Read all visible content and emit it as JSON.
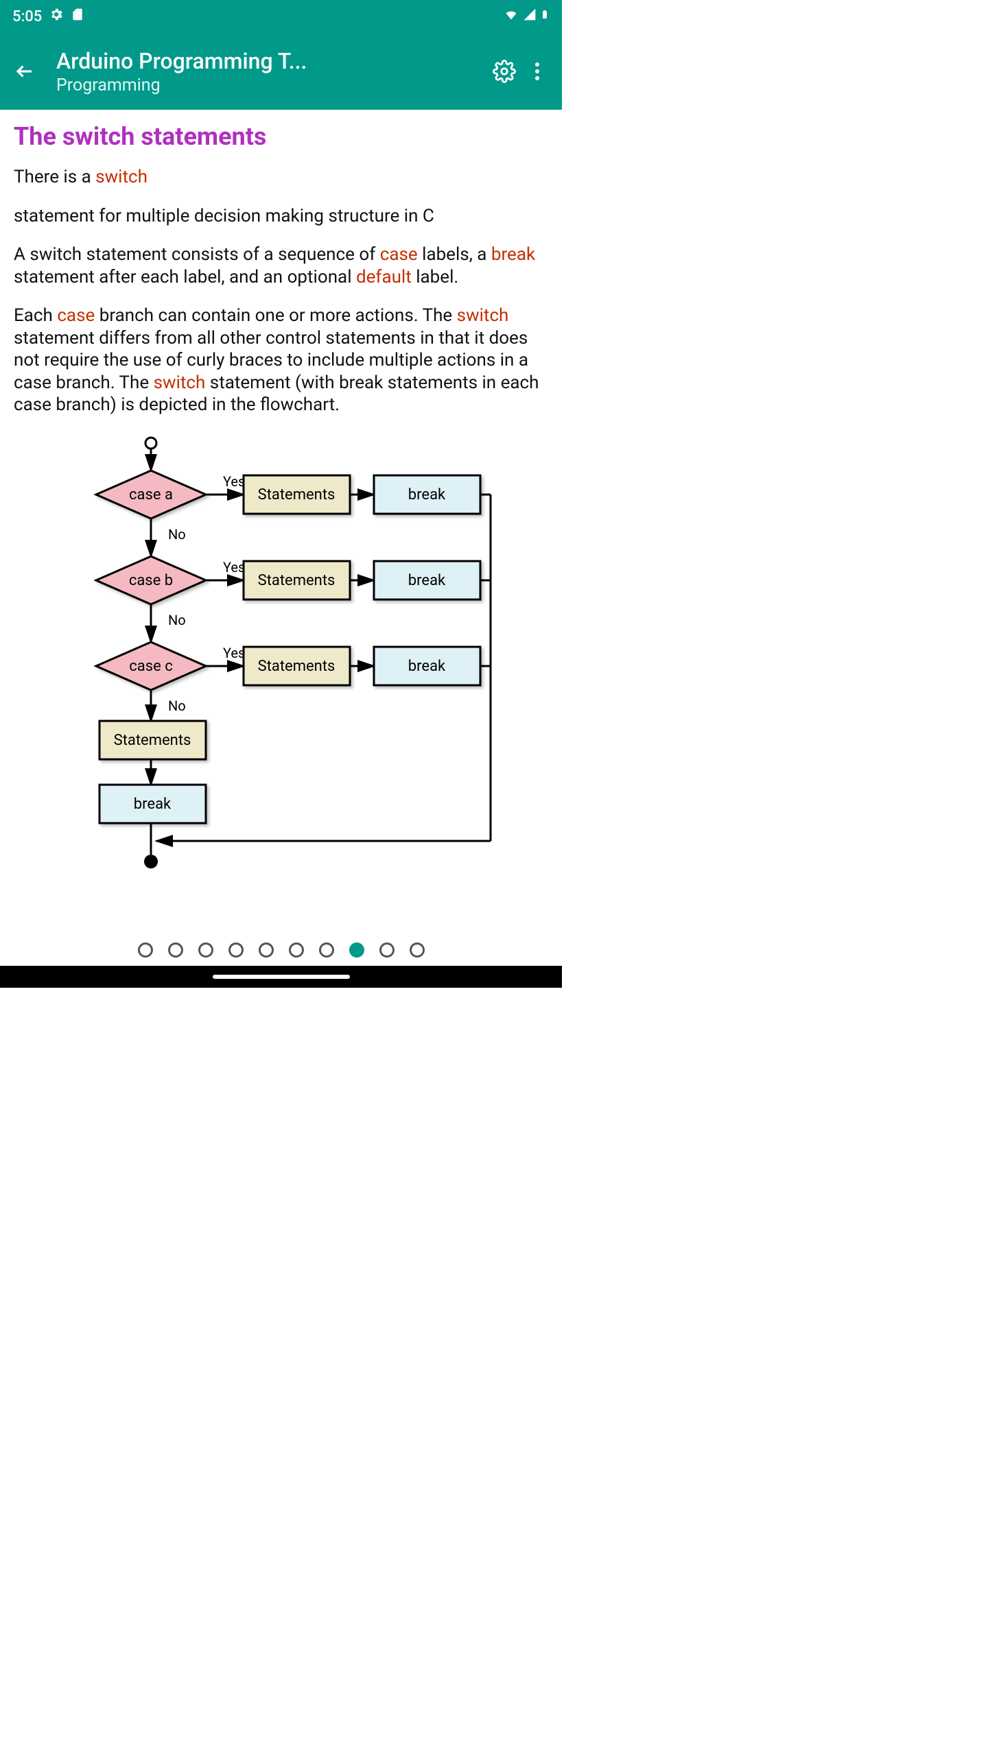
{
  "status": {
    "time": "5:05"
  },
  "header": {
    "title": "Arduino Programming T...",
    "subtitle": "Programming"
  },
  "content": {
    "heading": "The switch statements",
    "p1a": "There is a ",
    "p1b": "switch",
    "p2": "statement for multiple decision making structure in C",
    "p3a": "A switch statement consists of a sequence of ",
    "p3b": "case",
    "p3c": " labels, a ",
    "p3d": "break",
    "p3e": " statement after each label, and an optional ",
    "p3f": "default",
    "p3g": " label.",
    "p4a": "Each ",
    "p4b": "case",
    "p4c": " branch can contain one or more actions. The ",
    "p4d": "switch",
    "p4e": " statement differs from all other control statements in that it does not require the use of curly braces to include multiple actions in a case branch. The ",
    "p4f": "switch",
    "p4g": " statement (with break statements in each case branch) is depicted in the flowchart."
  },
  "flow": {
    "case_a": "case a",
    "case_b": "case b",
    "case_c": "case c",
    "yes": "Yes",
    "no": "No",
    "stmts": "Statements",
    "break": "break"
  },
  "pager": {
    "count": 10,
    "active": 7
  }
}
